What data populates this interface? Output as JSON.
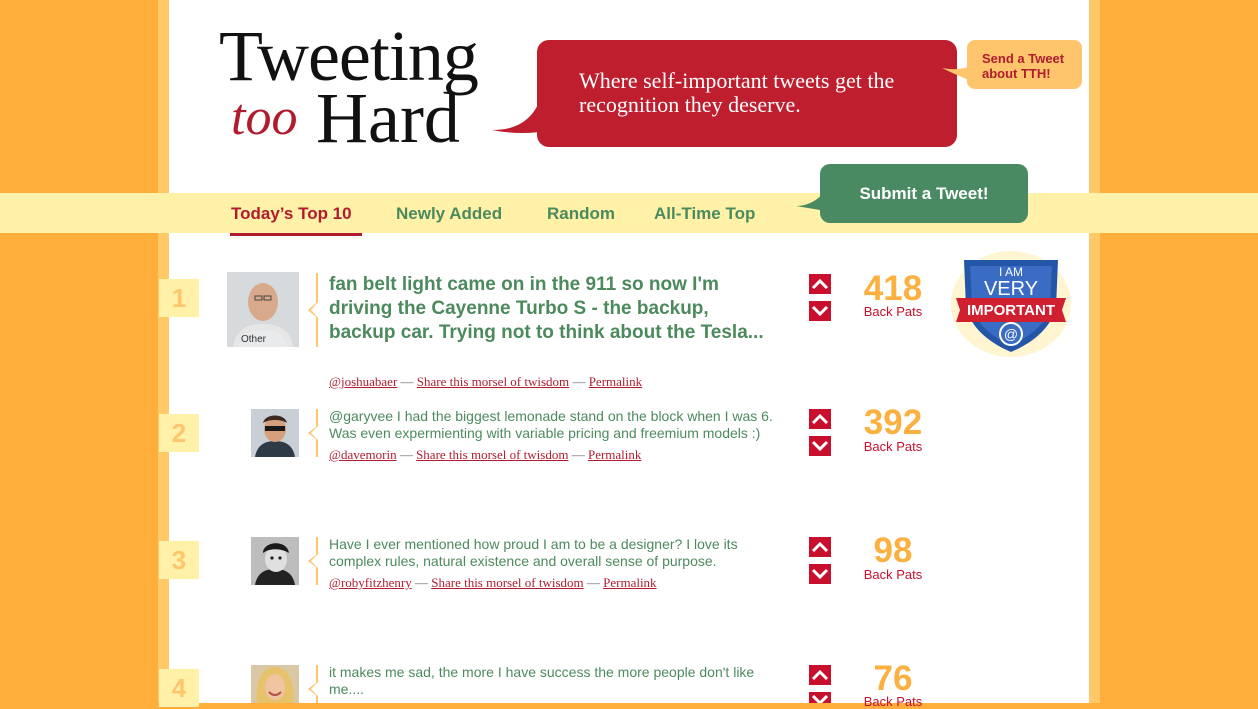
{
  "logo": {
    "line1": "Tweeting",
    "line2_italic": "too",
    "line2": "Hard"
  },
  "tagline": "Where self-important tweets get the recognition they deserve.",
  "send_tweet": "Send a Tweet about TTH!",
  "nav": [
    {
      "label": "Today’s Top 10",
      "active": true
    },
    {
      "label": "Newly Added"
    },
    {
      "label": "Random"
    },
    {
      "label": "All-Time Top"
    }
  ],
  "submit_button": "Submit a Tweet!",
  "badge": {
    "line1": "I AM",
    "line2": "VERY",
    "banner": "IMPORTANT",
    "symbol": "@"
  },
  "tweets": [
    {
      "rank": "1",
      "text": "fan belt light came on in the 911 so now I'm driving the Cayenne Turbo S - the backup, backup car. Trying not to think about the Tesla...",
      "user": "@joshuabaer",
      "share": "Share this morsel of twisdom",
      "permalink": "Permalink",
      "score": "418",
      "score_label": "Back Pats"
    },
    {
      "rank": "2",
      "text": "@garyvee I had the biggest lemonade stand on the block when I was 6. Was even expermienting with variable pricing and freemium models :)",
      "user": "@davemorin",
      "share": "Share this morsel of twisdom",
      "permalink": "Permalink",
      "score": "392",
      "score_label": "Back Pats"
    },
    {
      "rank": "3",
      "text": "Have I ever mentioned how proud I am to be a designer? I love its complex rules, natural existence and overall sense of purpose.",
      "user": "@robyfitzhenry",
      "share": "Share this morsel of twisdom",
      "permalink": "Permalink",
      "score": "98",
      "score_label": "Back Pats"
    },
    {
      "rank": "4",
      "text": "it makes me sad, the more I have success the more people don't like me....",
      "score": "76",
      "score_label": "Back Pats"
    }
  ],
  "separator": "—",
  "colors": {
    "brand_red": "#be1e2d",
    "brand_green": "#4a8a63",
    "score_orange": "#fbb040",
    "background_orange": "#ffae3c"
  }
}
